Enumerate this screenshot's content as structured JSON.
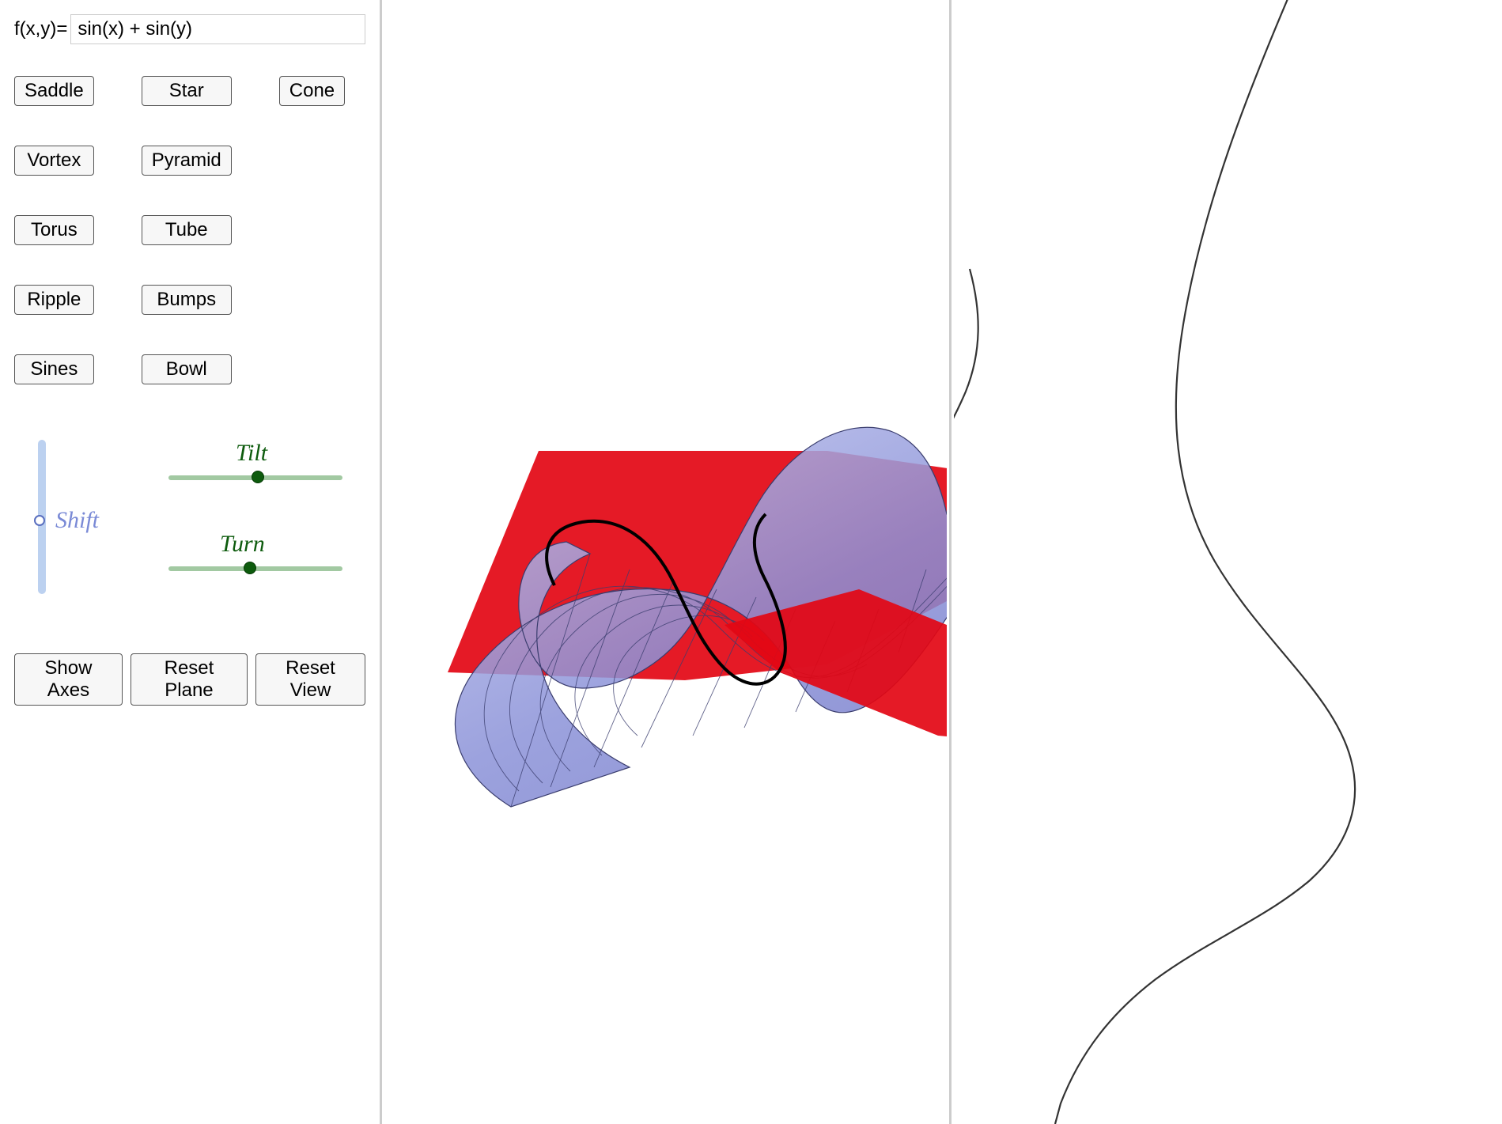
{
  "formula": {
    "label": "f(x,y)=",
    "value": "sin(x) + sin(y)"
  },
  "presets": {
    "saddle": "Saddle",
    "star": "Star",
    "cone": "Cone",
    "vortex": "Vortex",
    "pyramid": "Pyramid",
    "torus": "Torus",
    "tube": "Tube",
    "ripple": "Ripple",
    "bumps": "Bumps",
    "sines": "Sines",
    "bowl": "Bowl"
  },
  "sliders": {
    "shift_label": "Shift",
    "tilt_label": "Tilt",
    "turn_label": "Turn"
  },
  "actions": {
    "show_axes": "Show Axes",
    "reset_plane": "Reset Plane",
    "reset_view": "Reset View"
  },
  "colors": {
    "plane": "#e30613",
    "surface_hi": "#a9b0e8",
    "surface_lo": "#6a6fc2",
    "mesh": "#3a3d6e",
    "slider_green": "#0d5b0d",
    "slider_blue": "#7a8ad6",
    "curve": "#333"
  }
}
